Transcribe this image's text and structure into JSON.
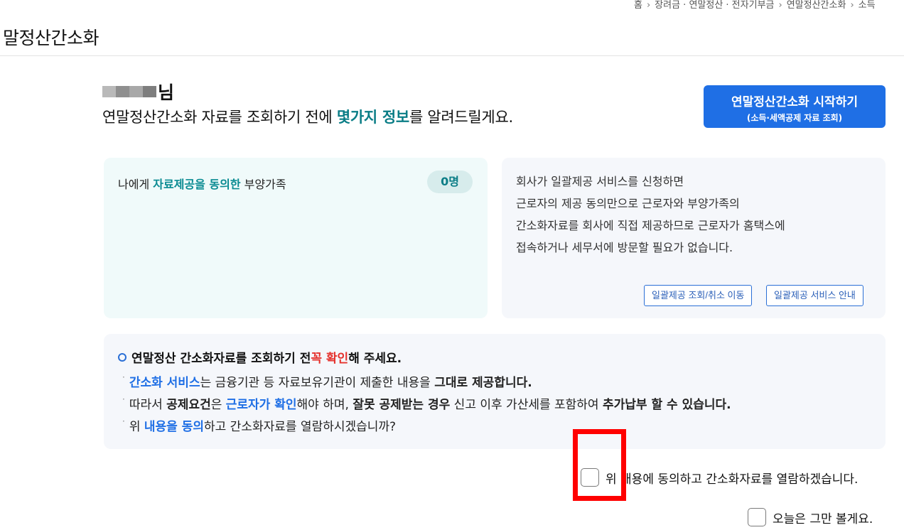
{
  "breadcrumb": [
    "홈",
    "장려금 · 연말정산 · 전자기부금",
    "연말정산간소화",
    "소득"
  ],
  "page_title": "말정산간소화",
  "user": {
    "suffix": "님"
  },
  "intro": {
    "before": "연말정산간소화 자료를 조회하기 전에 ",
    "highlight": "몇가지 정보",
    "after": "를 알려드릴게요."
  },
  "start_button": {
    "main": "연말정산간소화 시작하기",
    "sub": "(소득·세액공제 자료 조회)"
  },
  "dependents_box": {
    "label_before": "나에게 ",
    "label_highlight": "자료제공을 동의한",
    "label_after": " 부양가족",
    "count": "0명"
  },
  "bulk_info": {
    "lines": [
      "회사가 일괄제공 서비스를 신청하면",
      "근로자의 제공 동의만으로 근로자와 부양가족의",
      "간소화자료를 회사에 직접 제공하므로 근로자가 홈택스에",
      "접속하거나 세무서에 방문할 필요가 없습니다."
    ],
    "lookup_button": "일괄제공 조회/취소 이동",
    "guide_button": "일괄제공 서비스 안내"
  },
  "notice": {
    "head_before": "연말정산 간소화자료를 조회하기 전 ",
    "head_red": "꼭 확인",
    "head_after": "해 주세요.",
    "line1": {
      "blue": "간소화 서비스",
      "mid": "는 금융기관 등 자료보유기관이 제출한 내용을 ",
      "bold": "그대로 제공합니다."
    },
    "line2": {
      "pre": "따라서 ",
      "bold1": "공제요건",
      "mid1": "은 ",
      "blue": "근로자가 확인",
      "mid2": "해야 하며, ",
      "bold2": "잘못 공제받는 경우",
      "mid3": " 신고 이후 가산세를 포함하여 ",
      "bold3": "추가납부 할 수 있습니다."
    },
    "line3": {
      "pre": "위 ",
      "blue": "내용을 동의",
      "post": "하고 간소화자료를 열람하시겠습니까?"
    }
  },
  "agree_checkbox_label": "위 내용에 동의하고 간소화자료를 열람하겠습니다.",
  "hide_today_label": "오늘은 그만 볼게요.",
  "colors": {
    "accent": "#1f6fe5",
    "teal": "#0a7d86",
    "highlight_box": "#ff0000"
  }
}
